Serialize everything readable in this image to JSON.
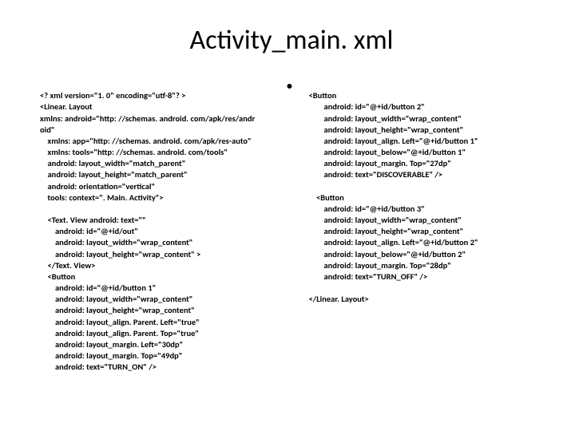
{
  "title": "Activity_main. xml",
  "left": {
    "l1": "<? xml version=\"1. 0\" encoding=\"utf-8\"? >",
    "l2": "<Linear. Layout",
    "l3": "xmlns: android=\"http: //schemas. android. com/apk/res/andr",
    "l4": "oid\"",
    "l5": "    xmlns: app=\"http: //schemas. android. com/apk/res-auto\"",
    "l6": "    xmlns: tools=\"http: //schemas. android. com/tools\"",
    "l7": "    android: layout_width=\"match_parent\"",
    "l8": "    android: layout_height=\"match_parent\"",
    "l9": "    android: orientation=\"vertical\"",
    "l10": "    tools: context=\". Main. Activity\">",
    "l11": "",
    "l12": "    <Text. View android: text=\"\"",
    "l13": "        android: id=\"@+id/out\"",
    "l14": "        android: layout_width=\"wrap_content\"",
    "l15": "        android: layout_height=\"wrap_content\" >",
    "l16": "    </Text. View>",
    "l17": "    <Button",
    "l18": "        android: id=\"@+id/button 1\"",
    "l19": "        android: layout_width=\"wrap_content\"",
    "l20": "        android: layout_height=\"wrap_content\"",
    "l21": "        android: layout_align. Parent. Left=\"true\"",
    "l22": "        android: layout_align. Parent. Top=\"true\"",
    "l23": "        android: layout_margin. Left=\"30dp\"",
    "l24": "        android: layout_margin. Top=\"49dp\"",
    "l25": "        android: text=\"TURN_ON\" />"
  },
  "right": {
    "bullet": "•",
    "r1": "    <Button",
    "r2": "            android: id=\"@+id/button 2\"",
    "r3": "            android: layout_width=\"wrap_content\"",
    "r4": "            android: layout_height=\"wrap_content\"",
    "r5": "            android: layout_align. Left=\"@+id/button 1\"",
    "r6": "            android: layout_below=\"@+id/button 1\"",
    "r7": "            android: layout_margin. Top=\"27dp\"",
    "r8": "            android: text=\"DISCOVERABLE\" />",
    "r9": "",
    "r10": "        <Button",
    "r11": "            android: id=\"@+id/button 3\"",
    "r12": "            android: layout_width=\"wrap_content\"",
    "r13": "            android: layout_height=\"wrap_content\"",
    "r14": "            android: layout_align. Left=\"@+id/button 2\"",
    "r15": "            android: layout_below=\"@+id/button 2\"",
    "r16": "            android: layout_margin. Top=\"28dp\"",
    "r17": "            android: text=\"TURN_OFF\" />",
    "r18": "",
    "r19": "    </Linear. Layout>"
  }
}
